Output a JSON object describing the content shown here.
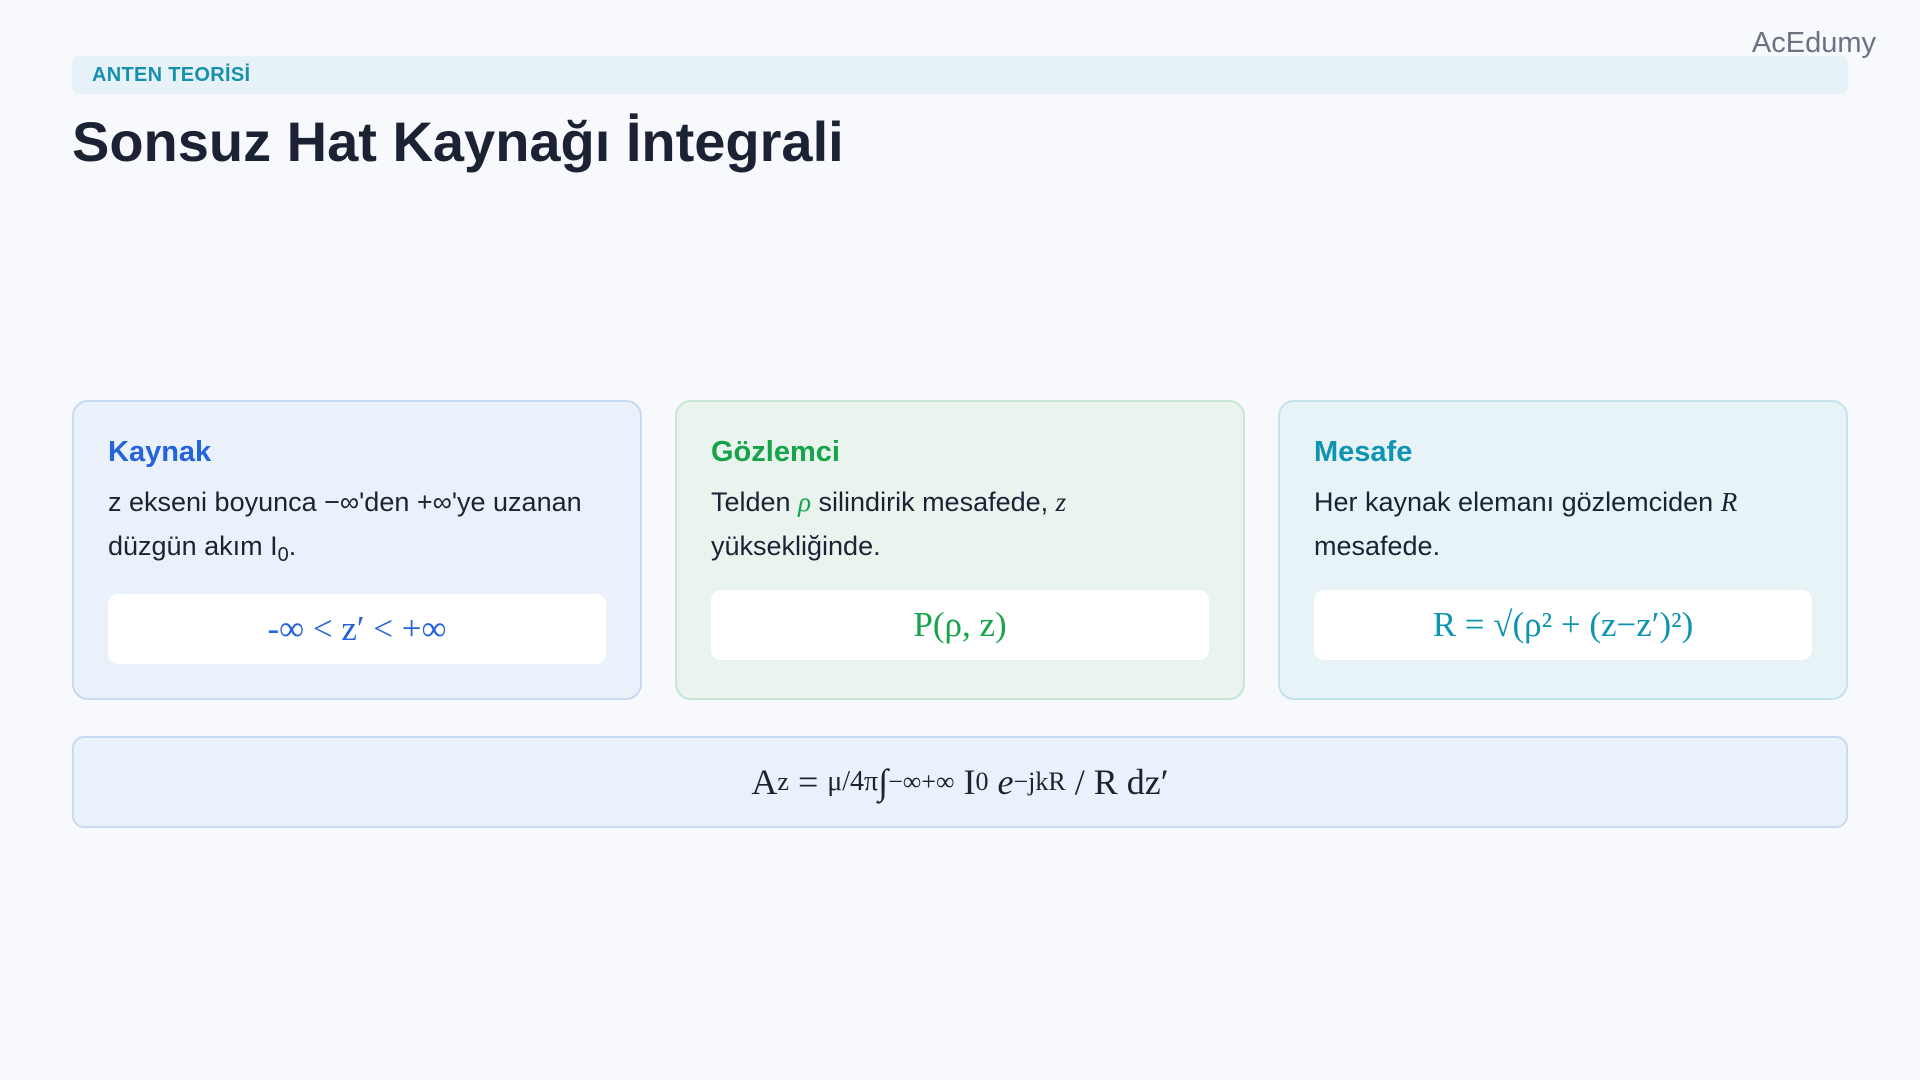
{
  "brand": "AcEdumy",
  "section_label": "ANTEN TEORİSİ",
  "title": "Sonsuz Hat Kaynağı İntegrali",
  "cards": [
    {
      "title": "Kaynak",
      "text_part1": "z ekseni boyunca −∞'den +∞'ye uzanan düzgün akım I",
      "text_sub": "0",
      "text_part2": ".",
      "formula": "-∞ < z′ < +∞",
      "accent": "#2563d9"
    },
    {
      "title": "Gözlemci",
      "text_part1": "Telden ",
      "text_symbol": "ρ",
      "text_part2": " silindirik mesafede, ",
      "text_symbol2": "z",
      "text_part3": " yüksekliğinde.",
      "formula": "P(ρ, z)",
      "accent": "#16a34a"
    },
    {
      "title": "Mesafe",
      "text_part1": "Her kaynak elemanı gözlemciden ",
      "text_symbol": "R",
      "text_part2": " mesafede.",
      "formula": "R = √(ρ² + (z−z′)²)",
      "accent": "#0e94b1"
    }
  ],
  "main_formula": {
    "lhs": "A",
    "lhs_sub": "z",
    "eq": " = ",
    "coef": "μ/4π",
    "integral": " ∫",
    "lower": "−∞",
    "upper": "+∞",
    "current": " I",
    "current_sub": "0",
    "exp_base": " e",
    "exp": "−jkR",
    "rest": " / R dz′"
  }
}
